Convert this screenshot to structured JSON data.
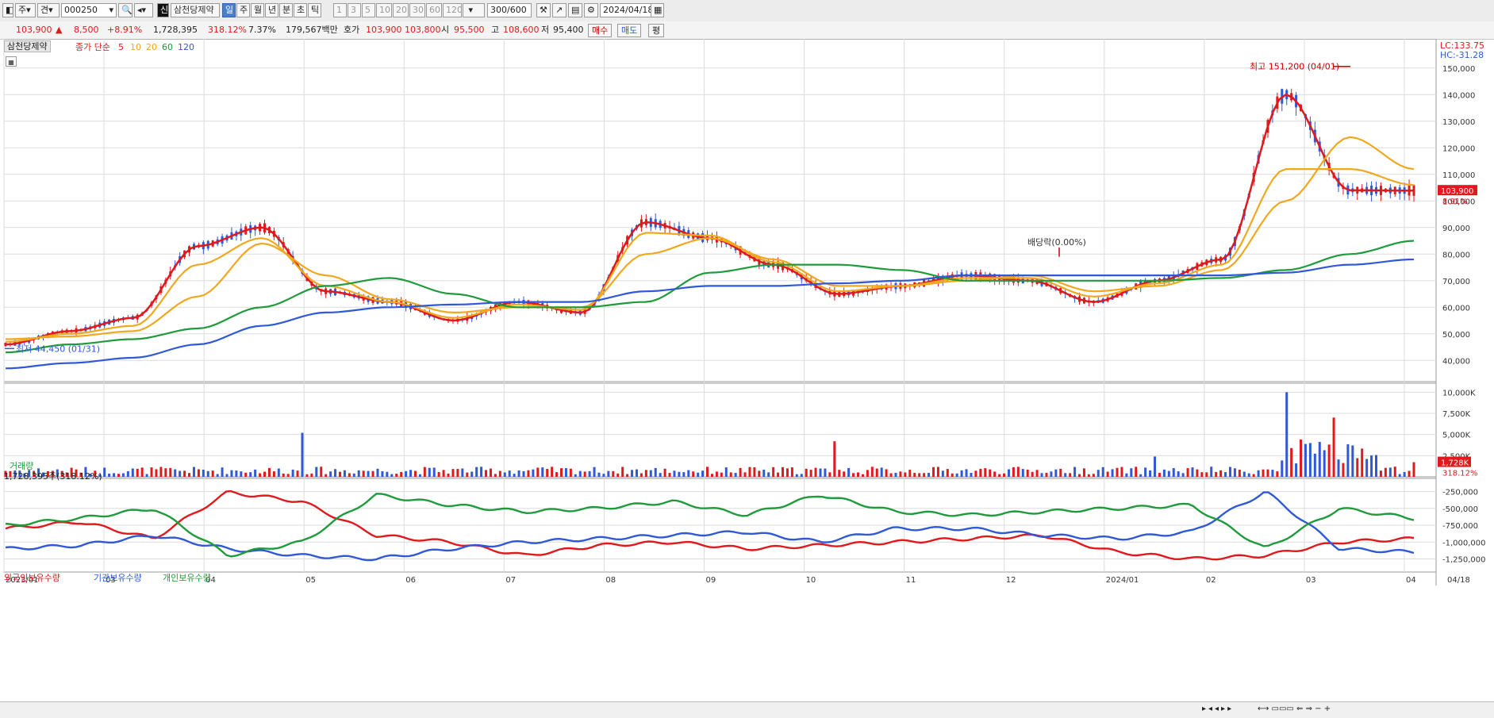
{
  "toolbar": {
    "item_type": "주",
    "view_type": "견",
    "code": "000250",
    "name": "삼천당제약",
    "periods": [
      "일",
      "주",
      "월",
      "년",
      "분",
      "초",
      "틱"
    ],
    "active_period": "일",
    "numbers": [
      "1",
      "3",
      "5",
      "10",
      "20",
      "30",
      "60",
      "120"
    ],
    "count": "300",
    "count_total": "/600",
    "date": "2024/04/18"
  },
  "quote": {
    "price": "103,900",
    "change": "8,500",
    "change_pct": "+8.91%",
    "volume": "1,728,395",
    "vol_ratio": "318.12%",
    "turnover": "7.37%",
    "amount": "179,567백만",
    "bid_label": "호가",
    "bid": "103,900",
    "ask": "103,800",
    "open_label": "시",
    "open": "95,500",
    "high_label": "고",
    "high": "108,600",
    "low_label": "저",
    "low": "95,400",
    "buy_label": "매수",
    "sell_label": "매도",
    "eval_label": "평"
  },
  "price_panel": {
    "name_tag": "삼천당제약",
    "ma_title": "종가 단순",
    "ma_periods": [
      "5",
      "10",
      "20",
      "60",
      "120"
    ],
    "ma_colors": [
      "#e0191c",
      "#f0a81e",
      "#f0a81e",
      "#1f9b3c",
      "#2f59d6"
    ],
    "lc_label": "LC:133.75",
    "hc_label": "HC:-31.28",
    "high_annotation": "최고 151,200 (04/01)",
    "low_annotation": "최저 44,450 (01/31)",
    "dividend_annotation": "배당락(0.00%)",
    "last_price_tag": "103,900",
    "last_pct_tag": "8.91%",
    "y_ticks": [
      "150,000",
      "140,000",
      "130,000",
      "120,000",
      "110,000",
      "100,000",
      "90,000",
      "80,000",
      "70,000",
      "60,000",
      "50,000",
      "40,000"
    ]
  },
  "volume_panel": {
    "title": "거래량",
    "summary": "1,728,395주(318.12%)",
    "y_ticks": [
      "10,000K",
      "7,500K",
      "5,000K",
      "2,500K"
    ],
    "last_tag": "1,728K",
    "last_pct": "318.12%"
  },
  "holding_panel": {
    "series_names": [
      "외국인보유수량",
      "기관보유수량",
      "개인보유수량"
    ],
    "series_colors": [
      "#e0191c",
      "#2f59d6",
      "#1f9b3c"
    ],
    "y_ticks": [
      "-250,000",
      "-500,000",
      "-750,000",
      "-1,000,000",
      "-1,250,000"
    ]
  },
  "x_axis": {
    "labels": [
      "2023/01",
      "03",
      "04",
      "05",
      "06",
      "07",
      "08",
      "09",
      "10",
      "11",
      "12",
      "2024/01",
      "02",
      "03",
      "04",
      "04/18"
    ]
  },
  "colors": {
    "up": "#e0191c",
    "down": "#2f59d6",
    "grid": "#dcdcdc",
    "accent": "#4a7fd0"
  },
  "chart_data": {
    "type": "line",
    "title": "삼천당제약",
    "x": [
      "2023/01",
      "03",
      "04",
      "05",
      "06",
      "07",
      "08",
      "09",
      "10",
      "11",
      "12",
      "2024/01",
      "02",
      "03",
      "04",
      "04/18"
    ],
    "ylim": [
      35000,
      155000
    ],
    "series": [
      {
        "name": "5",
        "values": [
          46000,
          51000,
          56000,
          83000,
          90000,
          66000,
          62000,
          55000,
          62000,
          58000,
          92000,
          86000,
          76000,
          65000,
          68000,
          72000,
          70000,
          62000,
          70000,
          78000,
          140000,
          104000,
          103900
        ]
      },
      {
        "name": "10",
        "values": [
          47000,
          50000,
          53000,
          76000,
          86000,
          68000,
          62000,
          56000,
          61000,
          59000,
          88000,
          87000,
          77000,
          66000,
          68000,
          71000,
          71000,
          64000,
          69000,
          76000,
          112000,
          112000,
          106000
        ]
      },
      {
        "name": "20",
        "values": [
          48000,
          49000,
          51000,
          64000,
          84000,
          72000,
          63000,
          58000,
          60000,
          60000,
          80000,
          86000,
          78000,
          68000,
          68000,
          70000,
          72000,
          66000,
          68000,
          74000,
          100000,
          124000,
          112000
        ]
      },
      {
        "name": "60",
        "values": [
          43000,
          46000,
          48000,
          52000,
          60000,
          68000,
          71000,
          65000,
          60000,
          60000,
          62000,
          73000,
          76000,
          76000,
          74000,
          70000,
          70000,
          70000,
          70000,
          71000,
          74000,
          80000,
          85000
        ]
      },
      {
        "name": "120",
        "values": [
          37000,
          39000,
          41000,
          46000,
          53000,
          58000,
          60000,
          61000,
          62000,
          62000,
          66000,
          68000,
          68000,
          69000,
          70000,
          72000,
          72000,
          72000,
          72000,
          72000,
          73000,
          76000,
          78000
        ]
      }
    ]
  }
}
